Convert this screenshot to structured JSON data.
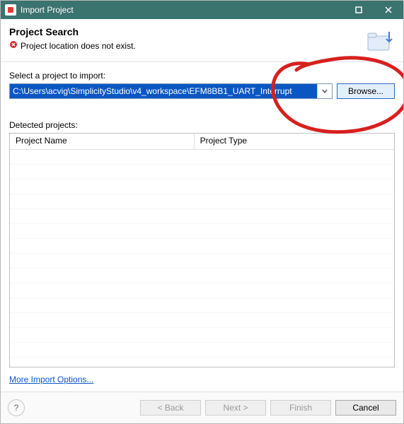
{
  "window": {
    "title": "Import Project"
  },
  "banner": {
    "heading": "Project Search",
    "error": "Project location does not exist."
  },
  "body": {
    "select_label": "Select a project to import:",
    "path_value": "C:\\Users\\acvig\\SimplicityStudio\\v4_workspace\\EFM8BB1_UART_Interrupt",
    "browse_label": "Browse...",
    "detected_label": "Detected projects:",
    "columns": {
      "name": "Project Name",
      "type": "Project Type"
    },
    "more_link": "More Import Options..."
  },
  "footer": {
    "back": "< Back",
    "next": "Next >",
    "finish": "Finish",
    "cancel": "Cancel"
  }
}
